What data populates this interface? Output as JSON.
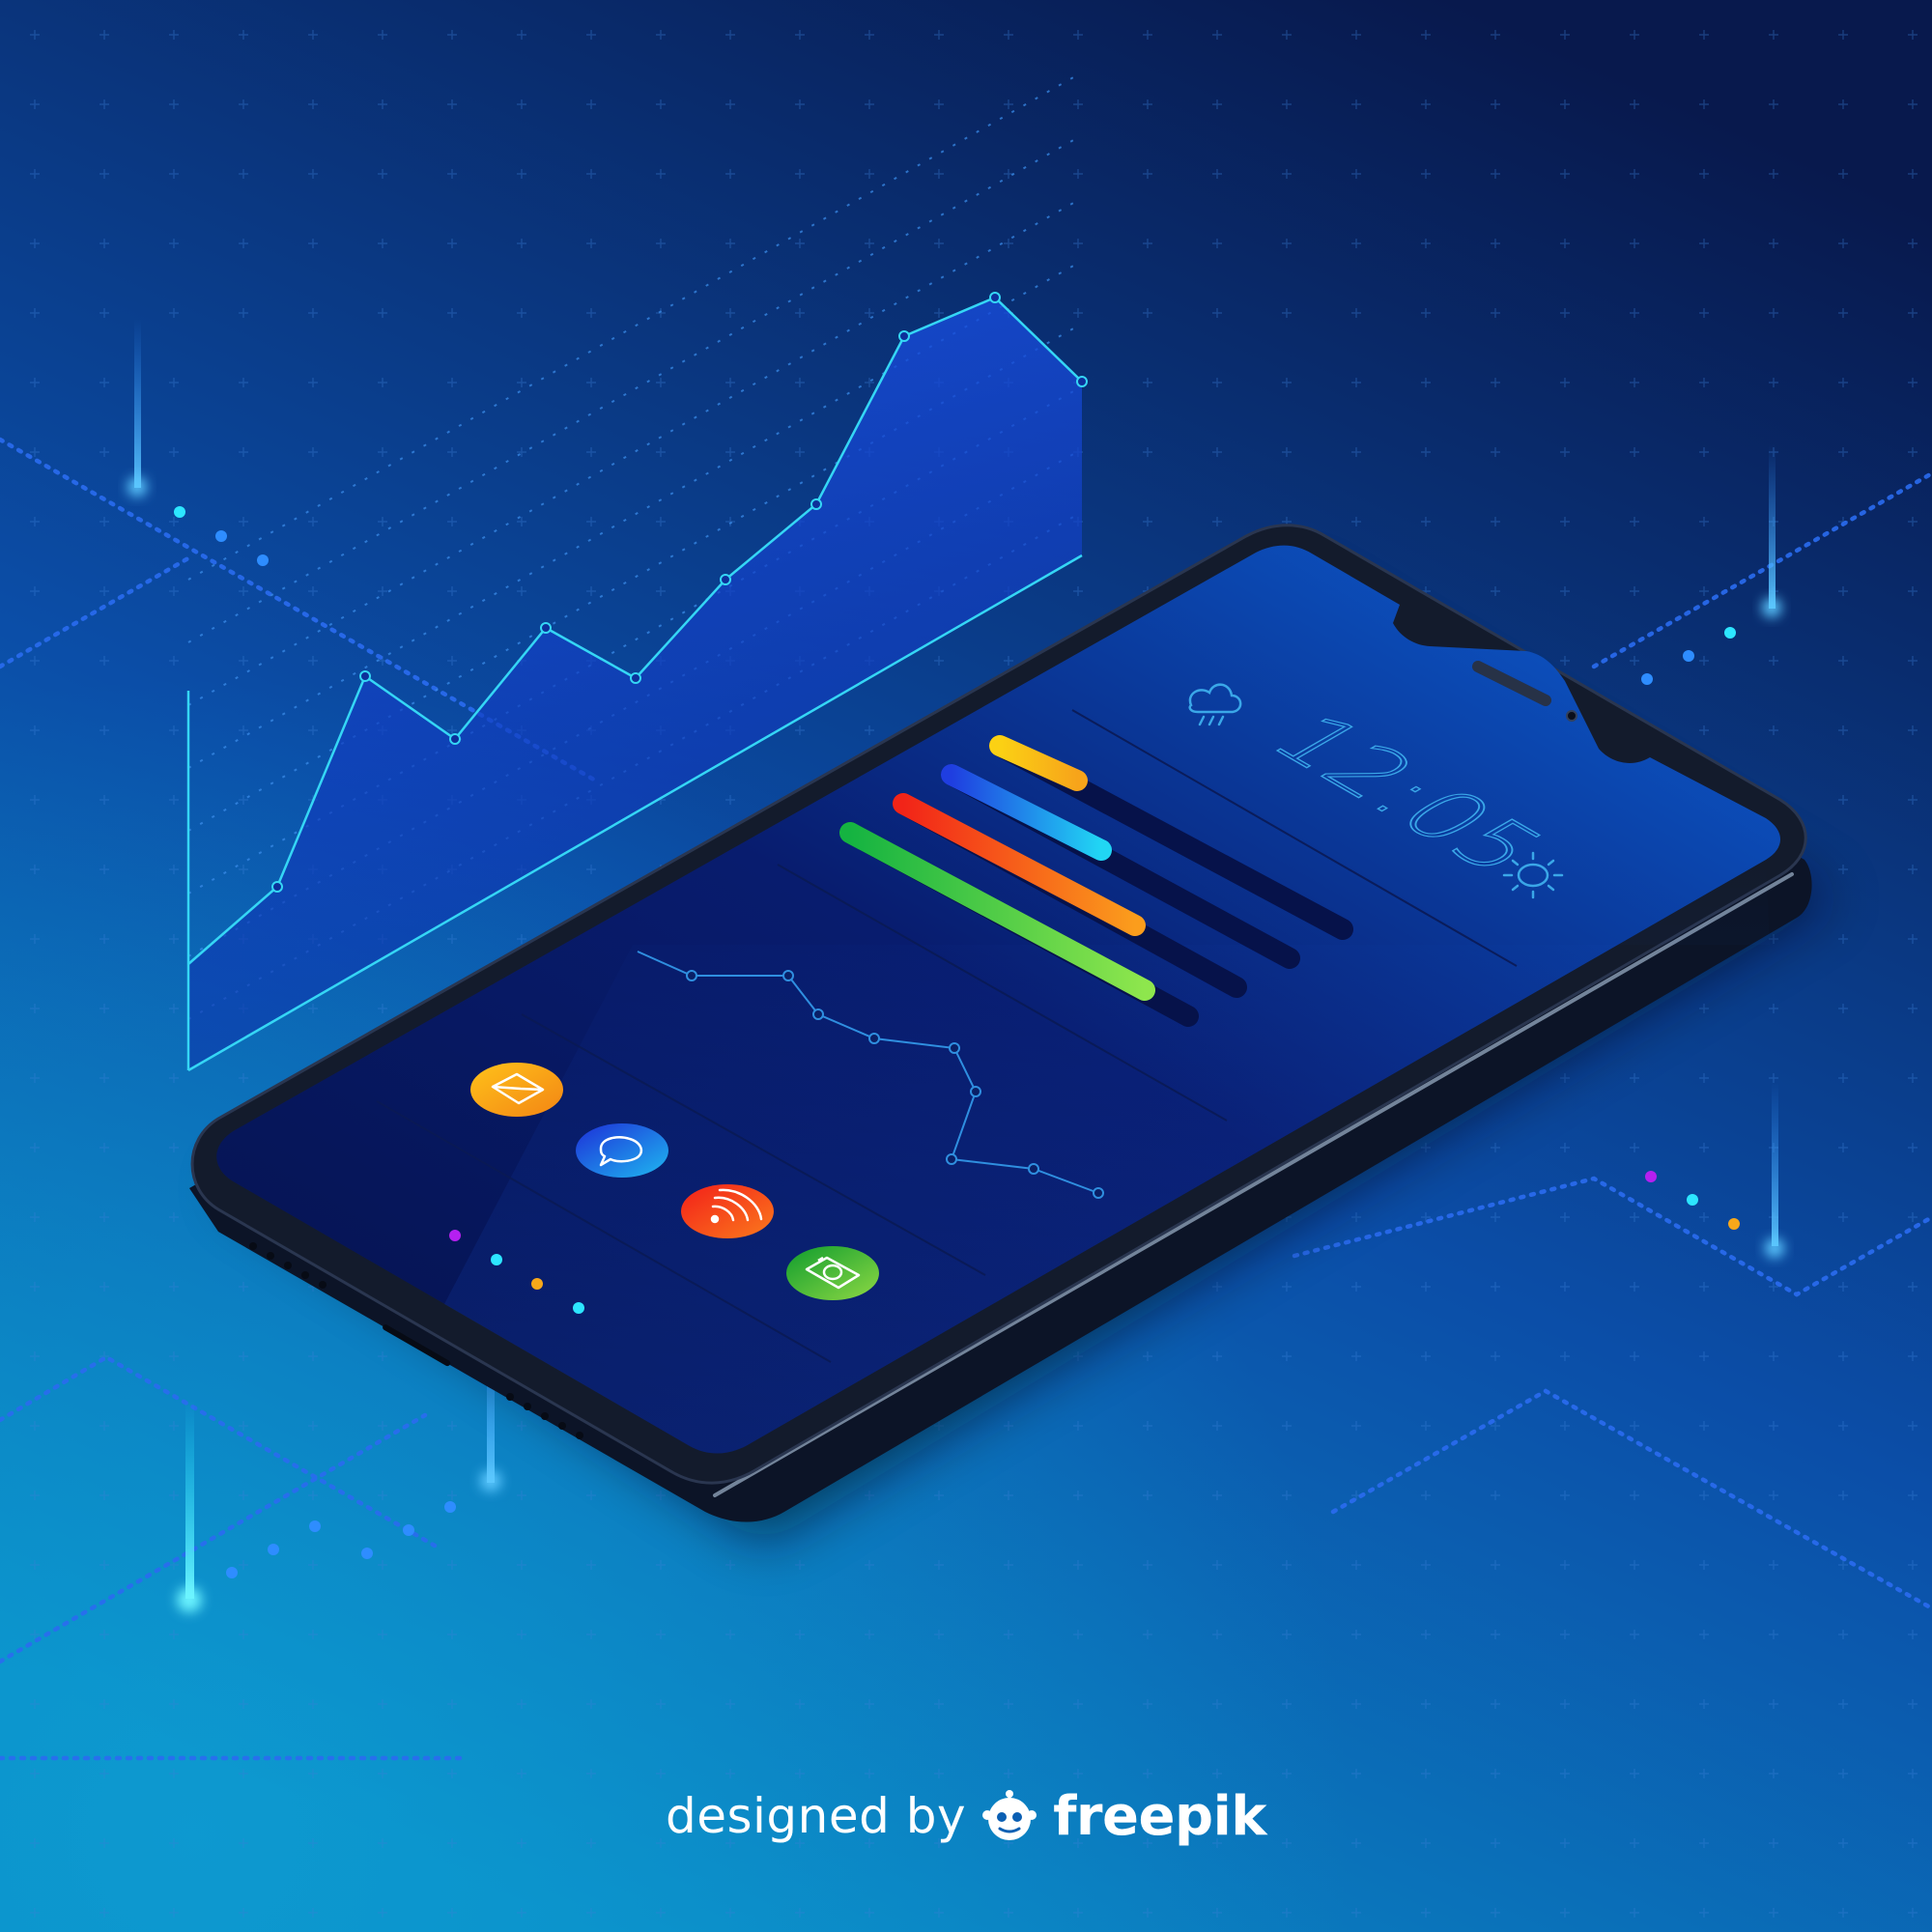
{
  "phone": {
    "clock": "12:05",
    "icons": [
      "cloud-rain-icon",
      "sun-icon",
      "mail-icon",
      "chat-icon",
      "rss-icon",
      "camera-icon"
    ],
    "app_colors": [
      "#f7a21b",
      "#1a48e0",
      "#f04a14",
      "#22b33c"
    ],
    "stat_bar_colors": [
      [
        "#fbd114",
        "#f7a41a"
      ],
      [
        "#1f3ee0",
        "#21d6f4"
      ],
      [
        "#f22418",
        "#fb9d1c"
      ],
      [
        "#15b341",
        "#8ee64d"
      ]
    ],
    "stat_bar_levels": [
      0.25,
      0.45,
      0.72,
      0.85
    ]
  },
  "indicator_dot_colors": [
    "#b520f0",
    "#2de6ff",
    "#f7a81a",
    "#2de6ff"
  ],
  "credit": {
    "prefix": "designed by",
    "brand": "freepik"
  },
  "palette": {
    "background_top": "#08194d",
    "background_bottom": "#0a8bc6",
    "accent_cyan": "#35d6f5",
    "chart_fill": "#1746d6"
  }
}
